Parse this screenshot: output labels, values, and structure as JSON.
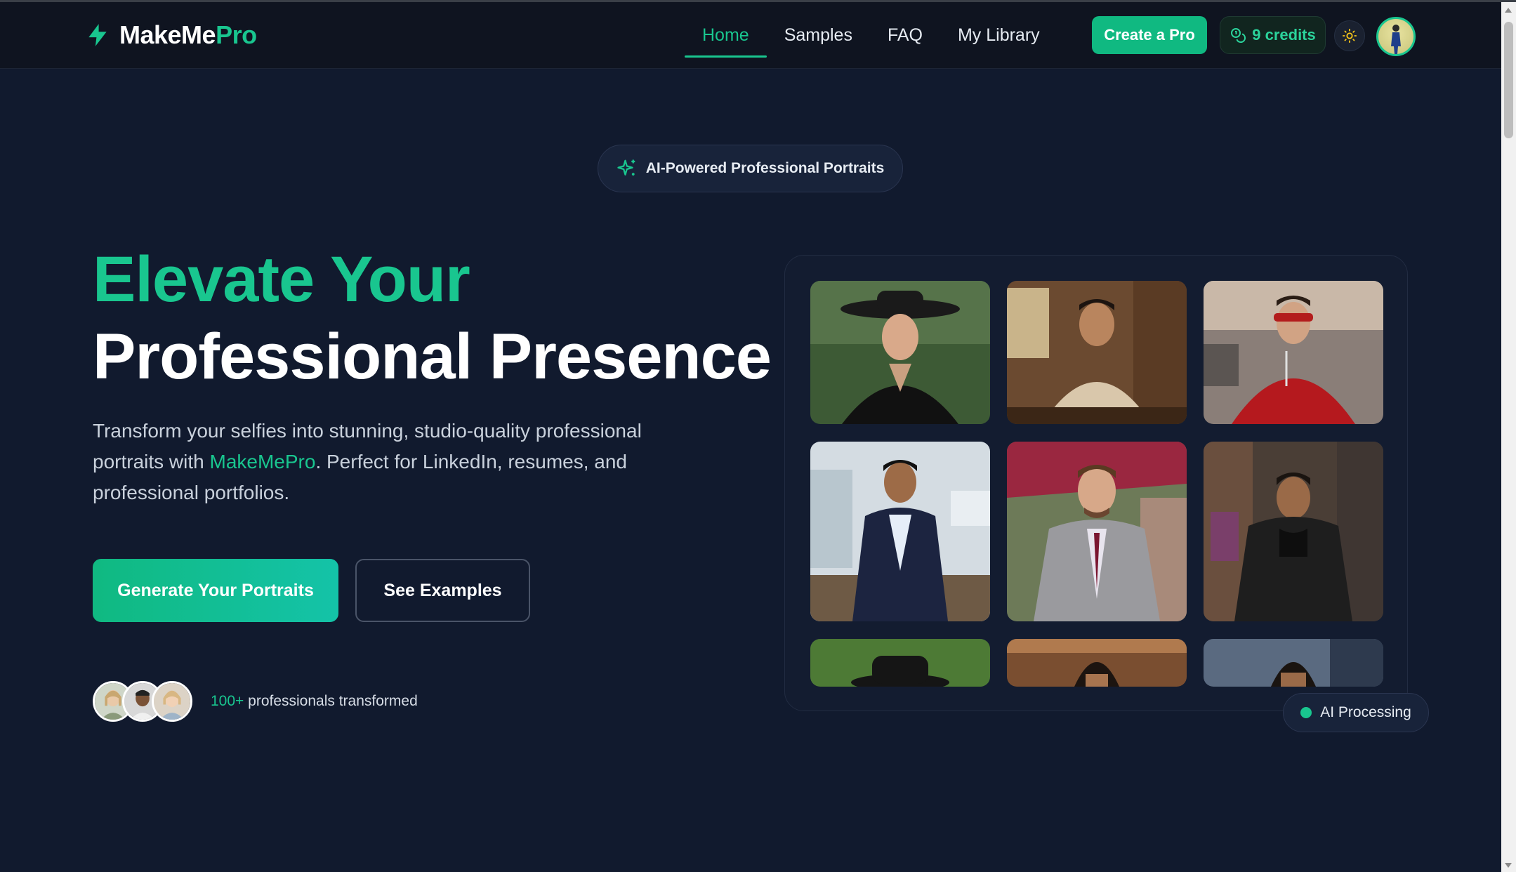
{
  "brand": {
    "name_part1": "MakeMe",
    "name_part2": "Pro"
  },
  "nav": {
    "links": [
      "Home",
      "Samples",
      "FAQ",
      "My Library"
    ],
    "active": "Home",
    "create_label": "Create a Pro",
    "credits_label": "9 credits"
  },
  "hero": {
    "badge": "AI-Powered Professional Portraits",
    "title_line1": "Elevate Your",
    "title_line2": "Professional Presence",
    "desc_part1": "Transform your selfies into stunning, studio-quality professional portraits with ",
    "desc_brand": "MakeMePro",
    "desc_part2": ". Perfect for LinkedIn, resumes, and professional portfolios.",
    "primary_cta": "Generate Your Portraits",
    "secondary_cta": "See Examples",
    "social_count": "100+",
    "social_text": " professionals transformed"
  },
  "gallery": {
    "status_label": "AI Processing"
  },
  "colors": {
    "accent": "#19c68f",
    "background": "#111a2e",
    "navbar": "#0f1420"
  }
}
